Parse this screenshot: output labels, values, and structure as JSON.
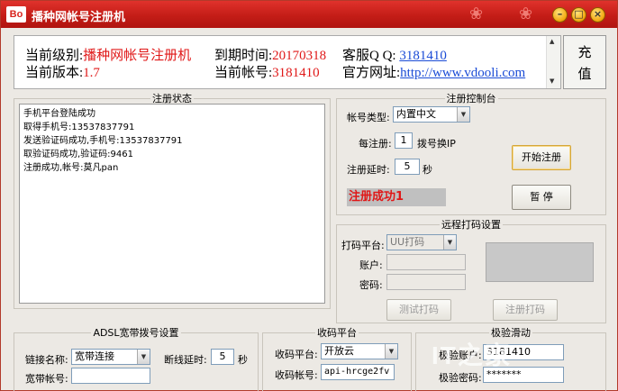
{
  "titlebar": {
    "icon_text": "Bo",
    "title": "播种网帐号注册机",
    "buttons": {
      "minimize": "–",
      "maximize": "□",
      "close": "×"
    }
  },
  "info": {
    "level_label": "当前级别:",
    "level_value": "播种网帐号注册机",
    "version_label": "当前版本:",
    "version_value": "1.7",
    "expire_label": "到期时间:",
    "expire_value": "20170318",
    "account_label": "当前帐号:",
    "account_value": "3181410",
    "qq_label": "客服Q Q:",
    "qq_value": "3181410",
    "site_label": "官方网址:",
    "site_value": "http://www.vdooli.com",
    "recharge_line1": "充",
    "recharge_line2": "值"
  },
  "reg_status": {
    "legend": "注册状态",
    "log": [
      "手机平台登陆成功",
      "取得手机号:13537837791",
      "发送验证码成功,手机号:13537837791",
      "取验证码成功,验证码:9461",
      "注册成功,帐号:莫凡pan"
    ]
  },
  "reg_console": {
    "legend": "注册控制台",
    "account_type_label": "帐号类型:",
    "account_type_value": "内置中文",
    "per_reg_label": "每注册:",
    "per_reg_value": "1",
    "per_reg_suffix": "拨号换IP",
    "delay_label": "注册延时:",
    "delay_value": "5",
    "delay_unit": "秒",
    "start_button": "开始注册",
    "pause_button": "暂 停",
    "status_text": "注册成功1"
  },
  "captcha": {
    "legend": "远程打码设置",
    "platform_label": "打码平台:",
    "platform_value": "UU打码",
    "account_label": "账户:",
    "password_label": "密码:",
    "test_button": "测试打码",
    "register_button": "注册打码"
  },
  "adsl": {
    "legend": "ADSL宽带拨号设置",
    "connection_label": "链接名称:",
    "connection_value": "宽带连接",
    "disconnect_delay_label": "断线延时:",
    "disconnect_delay_value": "5",
    "disconnect_delay_unit": "秒",
    "account_label": "宽带帐号:"
  },
  "sms": {
    "legend": "收码平台",
    "platform_label": "收码平台:",
    "platform_value": "开放云",
    "account_label": "收码帐号:",
    "account_value": "api-hrcge2fv"
  },
  "verify": {
    "legend": "极验滑动",
    "account_label": "极验账户:",
    "account_value": "3181410",
    "password_label": "极验密码:",
    "password_value": "*******"
  },
  "watermark": "IT之家"
}
